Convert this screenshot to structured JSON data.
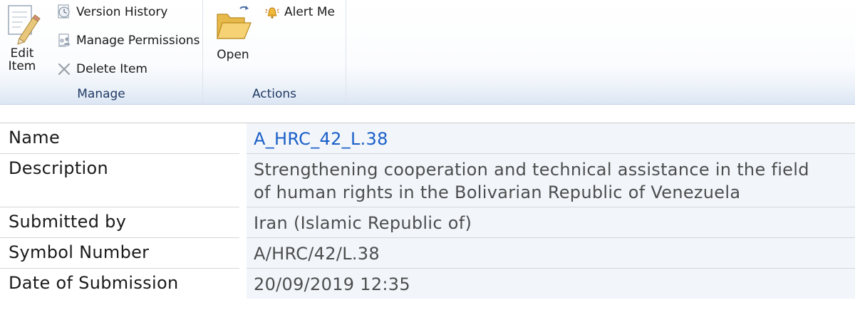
{
  "ribbon": {
    "manage": {
      "title": "Manage",
      "edit_item_line1": "Edit",
      "edit_item_line2": "Item",
      "version_history": "Version History",
      "manage_permissions": "Manage Permissions",
      "delete_item": "Delete Item"
    },
    "actions": {
      "title": "Actions",
      "open": "Open",
      "alert_me": "Alert Me"
    }
  },
  "properties": [
    {
      "label": "Name",
      "value": "A_HRC_42_L.38"
    },
    {
      "label": "Description",
      "value_line1": "Strengthening cooperation and technical assistance in the field",
      "value_line2": "of human rights in the Bolivarian Republic of Venezuela"
    },
    {
      "label": "Submitted by",
      "value": "Iran (Islamic Republic of)"
    },
    {
      "label": "Symbol Number",
      "value": "A/HRC/42/L.38"
    },
    {
      "label": "Date of Submission",
      "value": "20/09/2019 12:35"
    }
  ],
  "colors": {
    "link": "#1a5fc7",
    "ribbon_group_title": "#203a64",
    "value_background": "#f2f6fb"
  },
  "icons": [
    "edit-item-icon",
    "version-history-icon",
    "manage-permissions-icon",
    "delete-icon",
    "open-folder-icon",
    "alert-bell-icon"
  ]
}
